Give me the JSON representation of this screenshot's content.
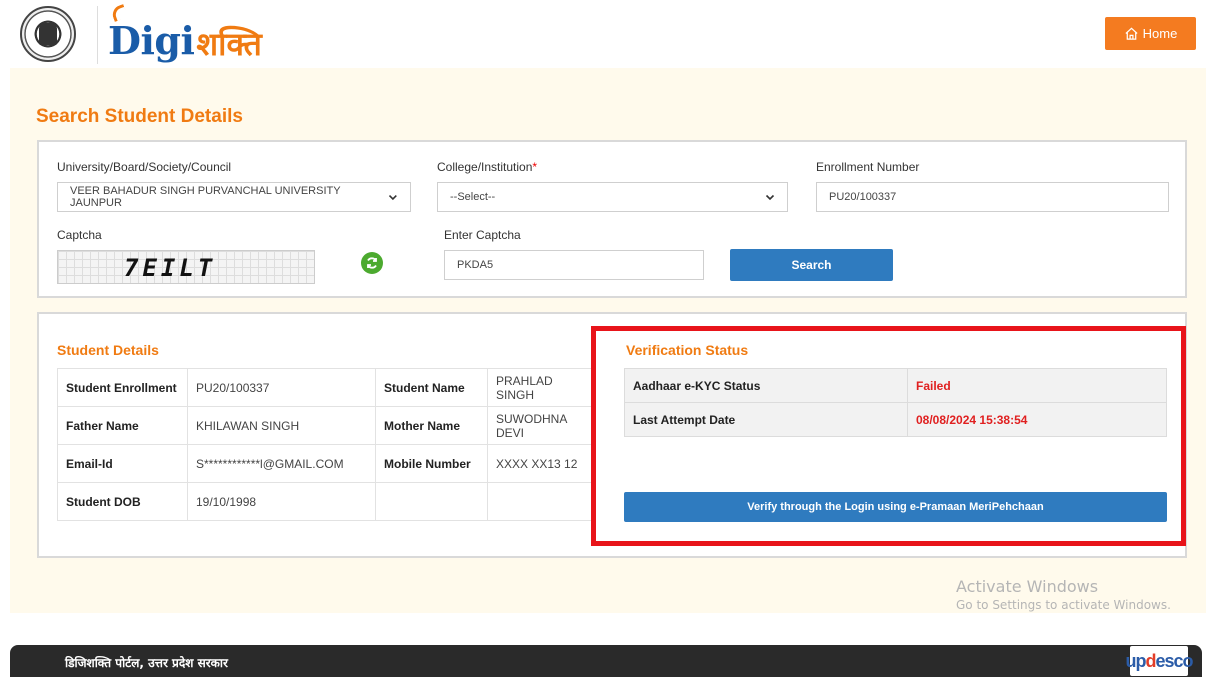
{
  "header": {
    "logo_latin": "Digi",
    "logo_hindi": "शक्ति",
    "home_label": "Home"
  },
  "page_title": "Search Student Details",
  "search": {
    "university_label": "University/Board/Society/Council",
    "university_value": "VEER BAHADUR SINGH PURVANCHAL UNIVERSITY JAUNPUR",
    "college_label": "College/Institution",
    "college_required_mark": "*",
    "college_value": "--Select--",
    "enrollment_label": "Enrollment Number",
    "enrollment_value": "PU20/100337",
    "captcha_label": "Captcha",
    "captcha_image_text": "7EILT",
    "enter_captcha_label": "Enter Captcha",
    "enter_captcha_value": "PKDA5",
    "search_button": "Search"
  },
  "student": {
    "title": "Student Details",
    "rows": [
      {
        "label1": "Student Enrollment",
        "value1": "PU20/100337",
        "label2": "Student Name",
        "value2": "PRAHLAD SINGH"
      },
      {
        "label1": "Father Name",
        "value1": "KHILAWAN SINGH",
        "label2": "Mother Name",
        "value2": "SUWODHNA DEVI"
      },
      {
        "label1": "Email-Id",
        "value1": "S************l@GMAIL.COM",
        "label2": "Mobile Number",
        "value2": "XXXX XX13 12"
      },
      {
        "label1": "Student DOB",
        "value1": "19/10/1998",
        "label2": "",
        "value2": ""
      }
    ]
  },
  "verification": {
    "title": "Verification Status",
    "rows": [
      {
        "label": "Aadhaar e-KYC Status",
        "value": "Failed"
      },
      {
        "label": "Last Attempt Date",
        "value": "08/08/2024 15:38:54"
      }
    ],
    "button": "Verify through the Login using e-Pramaan MeriPehchaan"
  },
  "watermark": {
    "line1": "Activate Windows",
    "line2": "Go to Settings to activate Windows."
  },
  "footer": {
    "text": "डिजिशक्ति पोर्टल, उत्तर प्रदेश सरकार",
    "logo_part1": "up",
    "logo_part2": "d",
    "logo_part3": "esco"
  },
  "colors": {
    "accent_orange": "#f07b12",
    "button_blue": "#2f7bbf",
    "status_red": "#e02020",
    "highlight_red": "#e8141a"
  }
}
